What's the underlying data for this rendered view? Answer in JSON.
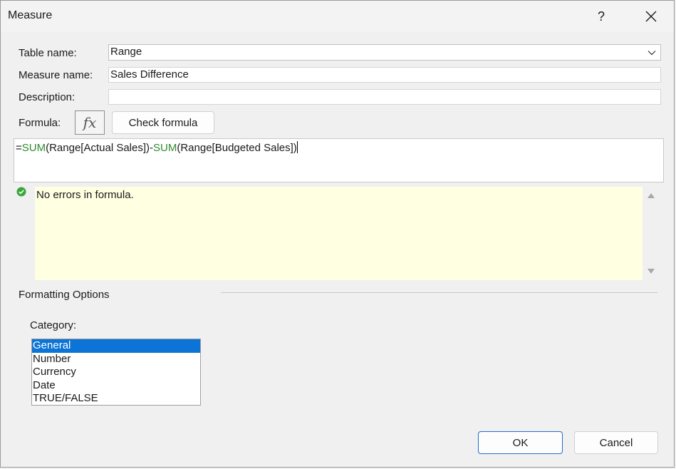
{
  "window": {
    "title": "Measure",
    "help_label": "?"
  },
  "form": {
    "table_name_label": "Table name:",
    "table_name_value": "Range",
    "measure_name_label": "Measure name:",
    "measure_name_value": "Sales Difference",
    "description_label": "Description:",
    "description_value": "",
    "formula_label": "Formula:",
    "fx_label": "fx",
    "check_formula_label": "Check formula"
  },
  "formula": {
    "parts": [
      "=",
      "SUM",
      "(Range[Actual Sales])-",
      "SUM",
      "(Range[Budgeted Sales])"
    ]
  },
  "status": {
    "message": "No errors in formula."
  },
  "formatting": {
    "section_title": "Formatting Options",
    "category_label": "Category:",
    "categories": [
      "General",
      "Number",
      "Currency",
      "Date",
      "TRUE/FALSE"
    ],
    "selected": "General"
  },
  "buttons": {
    "ok": "OK",
    "cancel": "Cancel"
  },
  "colors": {
    "function_green": "#2f8a2f",
    "status_background": "#ffffe1",
    "selection_blue": "#0b74d6",
    "ok_check_green": "#3aa63a"
  }
}
